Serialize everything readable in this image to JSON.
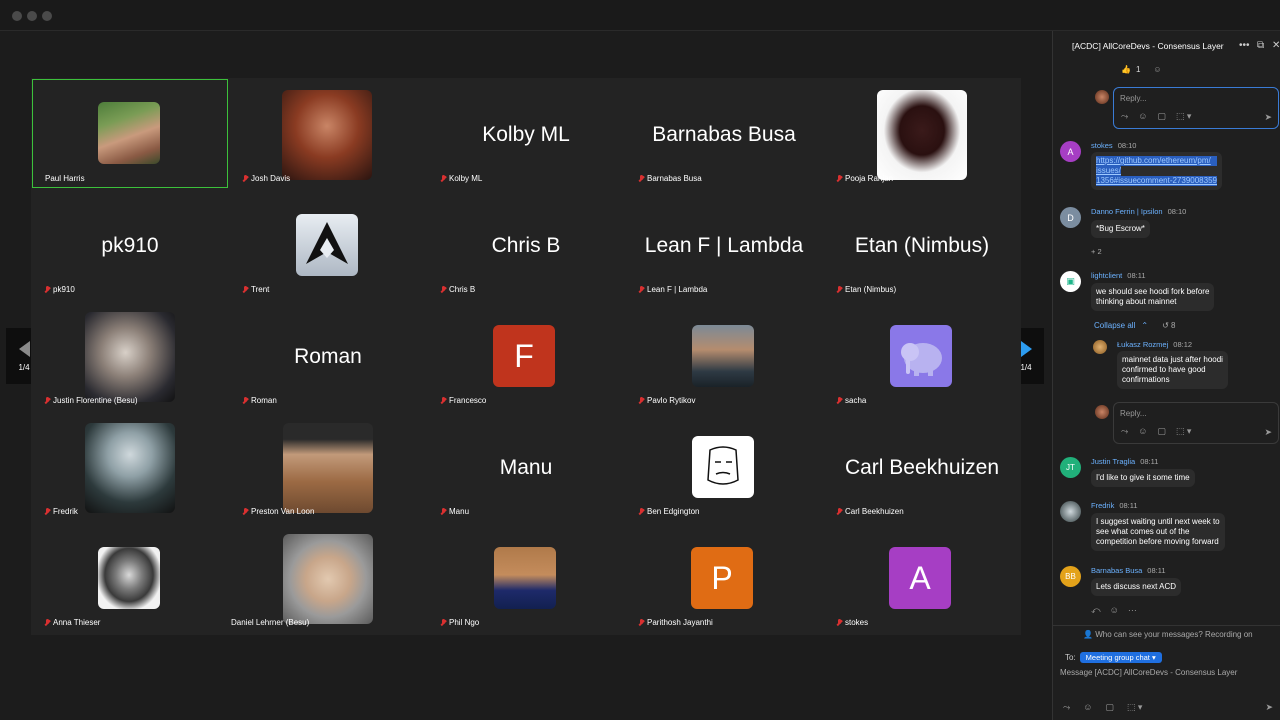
{
  "window": {
    "title": "[ACDC] AllCoreDevs - Consensus Layer"
  },
  "pager": {
    "prev_label": "1/4",
    "next_label": "1/4"
  },
  "tiles": [
    {
      "name": "Paul Harris"
    },
    {
      "name": "Josh Davis"
    },
    {
      "name": "Kolby ML",
      "big": "Kolby ML"
    },
    {
      "name": "Barnabas Busa",
      "big": "Barnabas Busa"
    },
    {
      "name": "Pooja Ranjan"
    },
    {
      "name": "pk910",
      "big": "pk910"
    },
    {
      "name": "Trent"
    },
    {
      "name": "Chris B",
      "big": "Chris B"
    },
    {
      "name": "Lean F | Lambda",
      "big": "Lean F | Lambda"
    },
    {
      "name": "Etan (Nimbus)",
      "big": "Etan (Nimbus)"
    },
    {
      "name": "Justin Florentine (Besu)"
    },
    {
      "name": "Roman",
      "big": "Roman"
    },
    {
      "name": "Francesco",
      "letter": "F"
    },
    {
      "name": "Pavlo Rytikov"
    },
    {
      "name": "sacha"
    },
    {
      "name": "Fredrik"
    },
    {
      "name": "Preston Van Loon"
    },
    {
      "name": "Manu",
      "big": "Manu"
    },
    {
      "name": "Ben Edgington"
    },
    {
      "name": "Carl Beekhuizen",
      "big": "Carl Beekhuizen"
    },
    {
      "name": "Anna Thieser"
    },
    {
      "name": "Daniel Lehrner (Besu)"
    },
    {
      "name": "Phil Ngo"
    },
    {
      "name": "Parithosh Jayanthi",
      "letter": "P"
    },
    {
      "name": "stokes",
      "letter": "A"
    }
  ],
  "chat": {
    "reaction_count": "1",
    "reply_placeholder": "Reply...",
    "messages": {
      "stokes": {
        "avatar": "A",
        "sender": "stokes",
        "time": "08:10",
        "link_l1": "https://github.com/ethereum/pm/",
        "link_l2": "issues/",
        "link_l3": "1356#issuecomment-2739008359"
      },
      "danno": {
        "avatar": "D",
        "sender": "Danno Ferrin | Ipsilon",
        "time": "08:10",
        "text": "*Bug Escrow*",
        "reactions": "2"
      },
      "lightclient": {
        "sender": "lightclient",
        "time": "08:11",
        "l1": "we should see hoodi fork before",
        "l2": "thinking about mainnet"
      },
      "thread": {
        "collapse": "Collapse all",
        "count": "8"
      },
      "lukasz": {
        "sender": "Łukasz Rozmej",
        "time": "08:12",
        "l1": "mainnet data just after hoodi",
        "l2": "confirmed to have good",
        "l3": "confirmations"
      },
      "justin": {
        "avatar": "JT",
        "sender": "Justin Traglia",
        "time": "08:11",
        "text": "I'd like to give it some time"
      },
      "fredrik": {
        "sender": "Fredrik",
        "time": "08:11",
        "l1": "I suggest waiting until next week to",
        "l2": "see what comes out of the",
        "l3": "competition before moving forward"
      },
      "barnabas": {
        "avatar": "BB",
        "sender": "Barnabas Busa",
        "time": "08:11",
        "text": "Lets discuss next ACD"
      }
    },
    "notice": "Who can see your messages? Recording on",
    "to_label": "To:",
    "to_value": "Meeting group chat",
    "input_placeholder": "Message [ACDC] AllCoreDevs - Consensus Layer"
  }
}
